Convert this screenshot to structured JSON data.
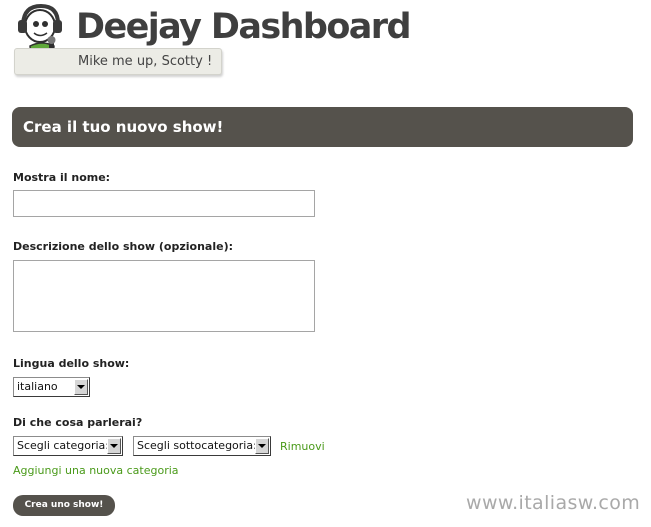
{
  "header": {
    "app_title": "Deejay Dashboard",
    "tagline": "Mike me up, Scotty !"
  },
  "form": {
    "title": "Crea il tuo nuovo show!",
    "name_label": "Mostra il nome:",
    "name_value": "",
    "description_label": "Descrizione dello show (opzionale):",
    "description_value": "",
    "language_label": "Lingua dello show:",
    "language_selected": "italiano",
    "topics_label": "Di che cosa parlerai?",
    "category_selected": "Scegli categoria:",
    "subcategory_selected": "Scegli sottocategoria:",
    "remove_link": "Rimuovi",
    "add_category_link": "Aggiungi una nuova categoria",
    "submit_label": "Crea uno show!"
  },
  "watermark": "www.italiasw.com",
  "colors": {
    "header_bar": "#55524c",
    "link": "#4a9a1a",
    "title": "#3f3f3f"
  }
}
